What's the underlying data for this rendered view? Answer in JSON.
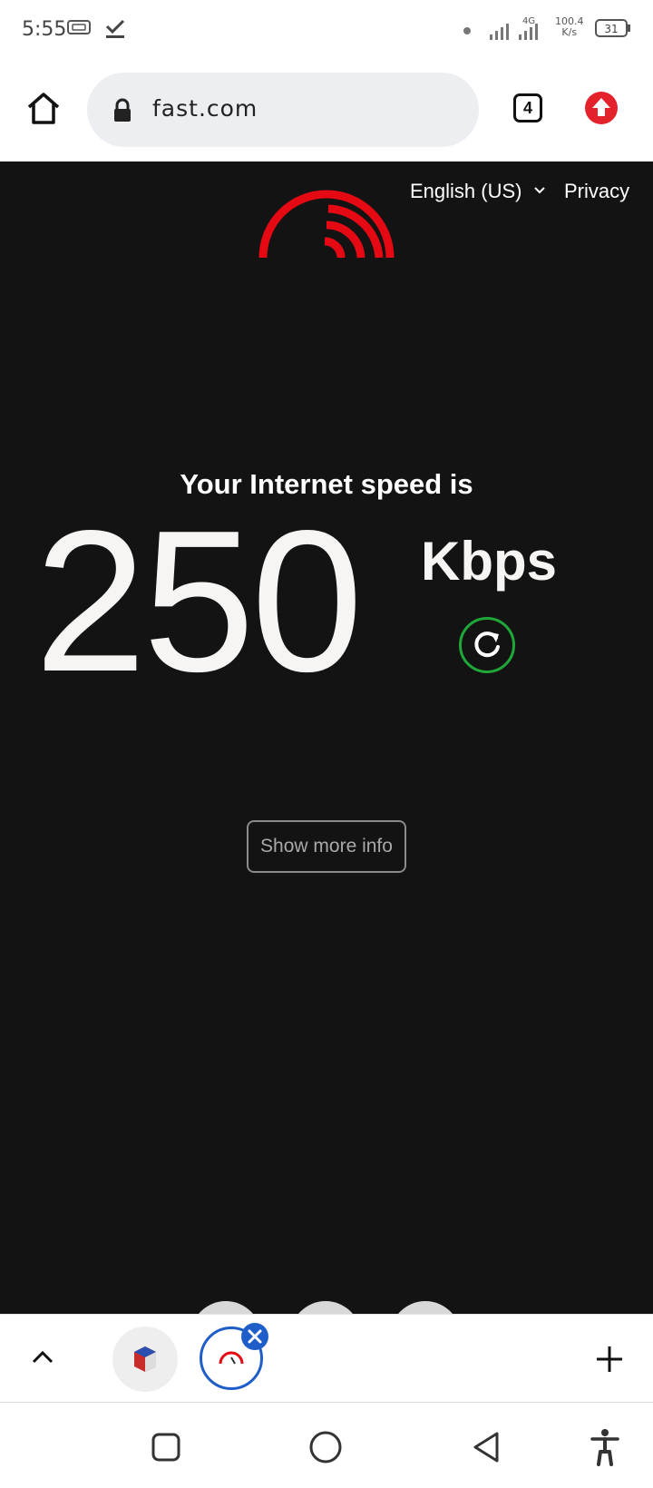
{
  "status_bar": {
    "time": "5:55",
    "network_type": "4G",
    "net_speed_value": "100.4",
    "net_speed_unit": "K/s",
    "battery": "31"
  },
  "browser": {
    "url": "fast.com",
    "tab_count": "4"
  },
  "page": {
    "language": "English (US)",
    "privacy": "Privacy",
    "heading": "Your Internet speed is",
    "speed_value": "250",
    "speed_units": "Kbps",
    "more_info_label": "Show more info"
  },
  "colors": {
    "page_bg": "#131313",
    "brand_red": "#e50914",
    "refresh_green": "#1fa839",
    "tab_blue": "#1f5ec9"
  },
  "icons": {
    "status": [
      "sim-card-icon",
      "download-done-icon",
      "signal-icon",
      "battery-icon"
    ],
    "toolbar": [
      "home-icon",
      "lock-icon",
      "tabs-icon",
      "update-icon"
    ],
    "tab_strip": [
      "chevron-up-icon",
      "tab-favicon-cube-icon",
      "tab-favicon-fast-icon",
      "close-icon",
      "plus-icon"
    ],
    "nav": [
      "recents-icon",
      "home-nav-icon",
      "back-icon",
      "accessibility-icon"
    ]
  }
}
